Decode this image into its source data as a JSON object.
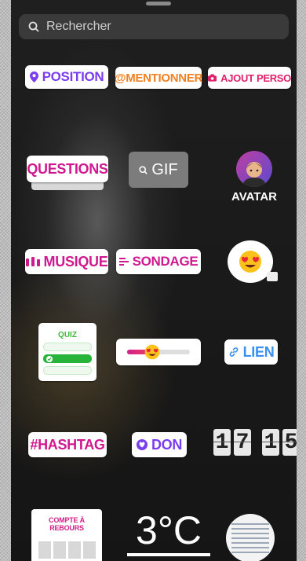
{
  "search": {
    "placeholder": "Rechercher"
  },
  "stickers": {
    "position": "POSITION",
    "mention": "@MENTIONNER",
    "ajout_perso": "AJOUT PERSO",
    "questions": "QUESTIONS",
    "gif": "GIF",
    "avatar": "AVATAR",
    "musique": "MUSIQUE",
    "sondage": "SONDAGE",
    "quiz": "QUIZ",
    "lien": "LIEN",
    "hashtag": "#HASHTAG",
    "don": "DON",
    "clock": {
      "h1": "1",
      "h2": "7",
      "m1": "1",
      "m2": "5"
    },
    "countdown": "COMPTE À REBOURS",
    "temperature": "3°C"
  },
  "icons": {
    "search": "search-icon",
    "position": "location-pin-icon",
    "ajout_perso": "camera-icon",
    "gif": "search-icon",
    "musique": "sound-bars-icon",
    "sondage": "poll-lines-icon",
    "lien": "link-icon",
    "don": "heart-icon",
    "emoji": "heart-eyes-emoji-icon"
  },
  "colors": {
    "purple": "#7a3df0",
    "orange": "#f08020",
    "pink": "#e0206a",
    "magenta": "#d01890",
    "blue": "#3a8ff0",
    "quiz_green": "#28b43a"
  },
  "slider_level": 0.4
}
